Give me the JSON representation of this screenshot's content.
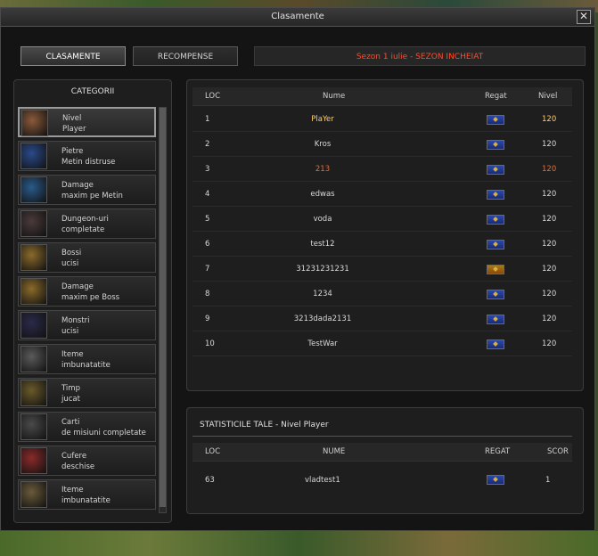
{
  "window": {
    "title": "Clasamente",
    "close_symbol": "✕"
  },
  "tabs": [
    {
      "label": "CLASAMENTE",
      "active": true
    },
    {
      "label": "RECOMPENSE",
      "active": false
    }
  ],
  "season_status": "Sezon 1 iulie - SEZON INCHEIAT",
  "categories": {
    "title": "CATEGORII",
    "items": [
      {
        "line1": "Nivel",
        "line2": "Player",
        "icon": "warrior-level-up-icon",
        "active": true
      },
      {
        "line1": "Pietre",
        "line2": "Metin distruse",
        "icon": "metin-stone-icon"
      },
      {
        "line1": "Damage",
        "line2": "maxim pe Metin",
        "icon": "metin-damage-icon"
      },
      {
        "line1": "Dungeon-uri",
        "line2": "completate",
        "icon": "dungeon-gate-icon"
      },
      {
        "line1": "Bossi",
        "line2": "ucisi",
        "icon": "boss-icon"
      },
      {
        "line1": "Damage",
        "line2": "maxim pe Boss",
        "icon": "boss-damage-icon"
      },
      {
        "line1": "Monstri",
        "line2": "ucisi",
        "icon": "monster-icon"
      },
      {
        "line1": "Iteme",
        "line2": "imbunatatite",
        "icon": "upgraded-weapon-icon"
      },
      {
        "line1": "Timp",
        "line2": "jucat",
        "icon": "pocket-watch-icon"
      },
      {
        "line1": "Carti",
        "line2": "de misiuni completate",
        "icon": "mission-cards-icon"
      },
      {
        "line1": "Cufere",
        "line2": "deschise",
        "icon": "treasure-chest-icon"
      },
      {
        "line1": "Iteme",
        "line2": "imbunatatite",
        "icon": "upgrade-scroll-icon"
      }
    ]
  },
  "ranking": {
    "headers": {
      "loc": "LOC",
      "name": "Nume",
      "kingdom": "Regat",
      "level": "Nivel"
    },
    "rows": [
      {
        "loc": "1",
        "name": "PlaYer",
        "kingdom": "blue",
        "level": "120",
        "highlight": "gold"
      },
      {
        "loc": "2",
        "name": "Kros",
        "kingdom": "blue",
        "level": "120"
      },
      {
        "loc": "3",
        "name": "213",
        "kingdom": "blue",
        "level": "120",
        "highlight": "orange"
      },
      {
        "loc": "4",
        "name": "edwas",
        "kingdom": "blue",
        "level": "120"
      },
      {
        "loc": "5",
        "name": "voda",
        "kingdom": "blue",
        "level": "120"
      },
      {
        "loc": "6",
        "name": "test12",
        "kingdom": "blue",
        "level": "120"
      },
      {
        "loc": "7",
        "name": "31231231231",
        "kingdom": "red",
        "level": "120"
      },
      {
        "loc": "8",
        "name": "1234",
        "kingdom": "blue",
        "level": "120"
      },
      {
        "loc": "9",
        "name": "3213dada2131",
        "kingdom": "blue",
        "level": "120"
      },
      {
        "loc": "10",
        "name": "TestWar",
        "kingdom": "blue",
        "level": "120"
      }
    ]
  },
  "stats": {
    "title": "STATISTICILE TALE - Nivel Player",
    "headers": {
      "loc": "LOC",
      "name": "NUME",
      "kingdom": "REGAT",
      "score": "SCOR"
    },
    "row": {
      "loc": "63",
      "name": "vladtest1",
      "kingdom": "blue",
      "score": "1"
    }
  },
  "colors": {
    "gold": "#ffcf6a",
    "orange": "#e0703a",
    "season_red": "#ff4a2a"
  }
}
